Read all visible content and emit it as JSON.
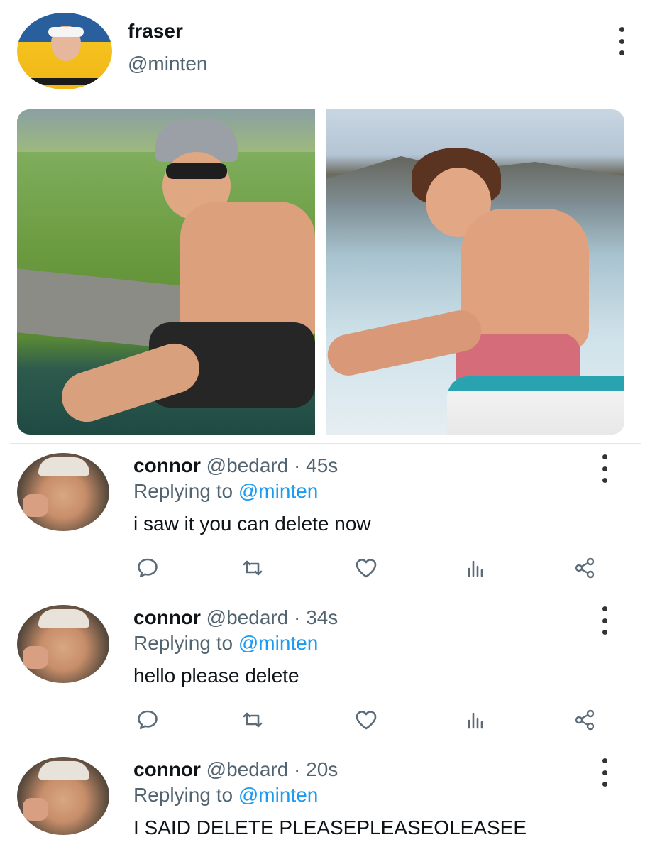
{
  "post": {
    "author_name": "fraser",
    "author_handle": "@minten",
    "photos": [
      {
        "alt": "left-photo"
      },
      {
        "alt": "right-photo"
      }
    ]
  },
  "replies": [
    {
      "name": "connor",
      "meta": "@bedard · 45s",
      "replying_label": "Replying to ",
      "replying_to": "@minten",
      "text": "i saw it you can delete now"
    },
    {
      "name": "connor",
      "meta": "@bedard · 34s",
      "replying_label": "Replying to ",
      "replying_to": "@minten",
      "text": "hello please delete"
    },
    {
      "name": "connor",
      "meta": "@bedard · 20s",
      "replying_label": "Replying to ",
      "replying_to": "@minten",
      "text": "I SAID DELETE PLEASEPLEASEOLEASEE"
    }
  ],
  "icons": {
    "reply": "comment-icon",
    "retweet": "retweet-icon",
    "like": "heart-icon",
    "views": "analytics-icon",
    "share": "share-icon",
    "more": "more-vertical-icon"
  },
  "colors": {
    "accent": "#1d9bf0",
    "secondary_text": "#536471",
    "icon": "#5b6b78"
  }
}
